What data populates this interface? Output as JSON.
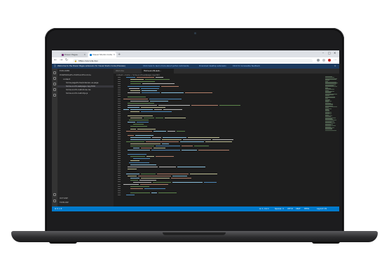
{
  "browser": {
    "tabs": [
      {
        "label": "Power Pages",
        "active": false
      },
      {
        "label": "Visual Studio Code",
        "active": true
      }
    ],
    "address": "https://vscode.dev"
  },
  "notification": {
    "message": "Welcome to the Power Pages extension for Visual Studio Code (Preview)",
    "links": [
      "Click here to learn more about portal commands",
      "Download desktop extension",
      "Click for Accessible feedback"
    ]
  },
  "explorer": {
    "title": "EXPLORER",
    "folder": "POWERPAGES-PORTALDEVLOCAL",
    "items": [
      {
        "label": "content",
        "selected": false
      },
      {
        "label": "home-page/home/index/en-us.page",
        "selected": false
      },
      {
        "label": "home.en-US.webpage.copy.html",
        "selected": true
      },
      {
        "label": "home.en-US.customcss.css",
        "selected": false
      },
      {
        "label": "home.en-US.customjs.js",
        "selected": false
      }
    ],
    "outline": "OUTLINE",
    "timeline": "TIMELINE"
  },
  "editor": {
    "tabs": [
      {
        "label": "Welcome",
        "active": false
      },
      {
        "label": "Home.en-US.web...",
        "active": true
      }
    ],
    "breadcrumb": "content > home > home.en-US.webpage.copy.html"
  },
  "status": {
    "left": "⊗ 0 ⚠ 0",
    "right": [
      "Ln 1, Col 1",
      "Spaces: 4",
      "UTF-8",
      "CRLF",
      "HTML",
      "Layout: US"
    ]
  }
}
